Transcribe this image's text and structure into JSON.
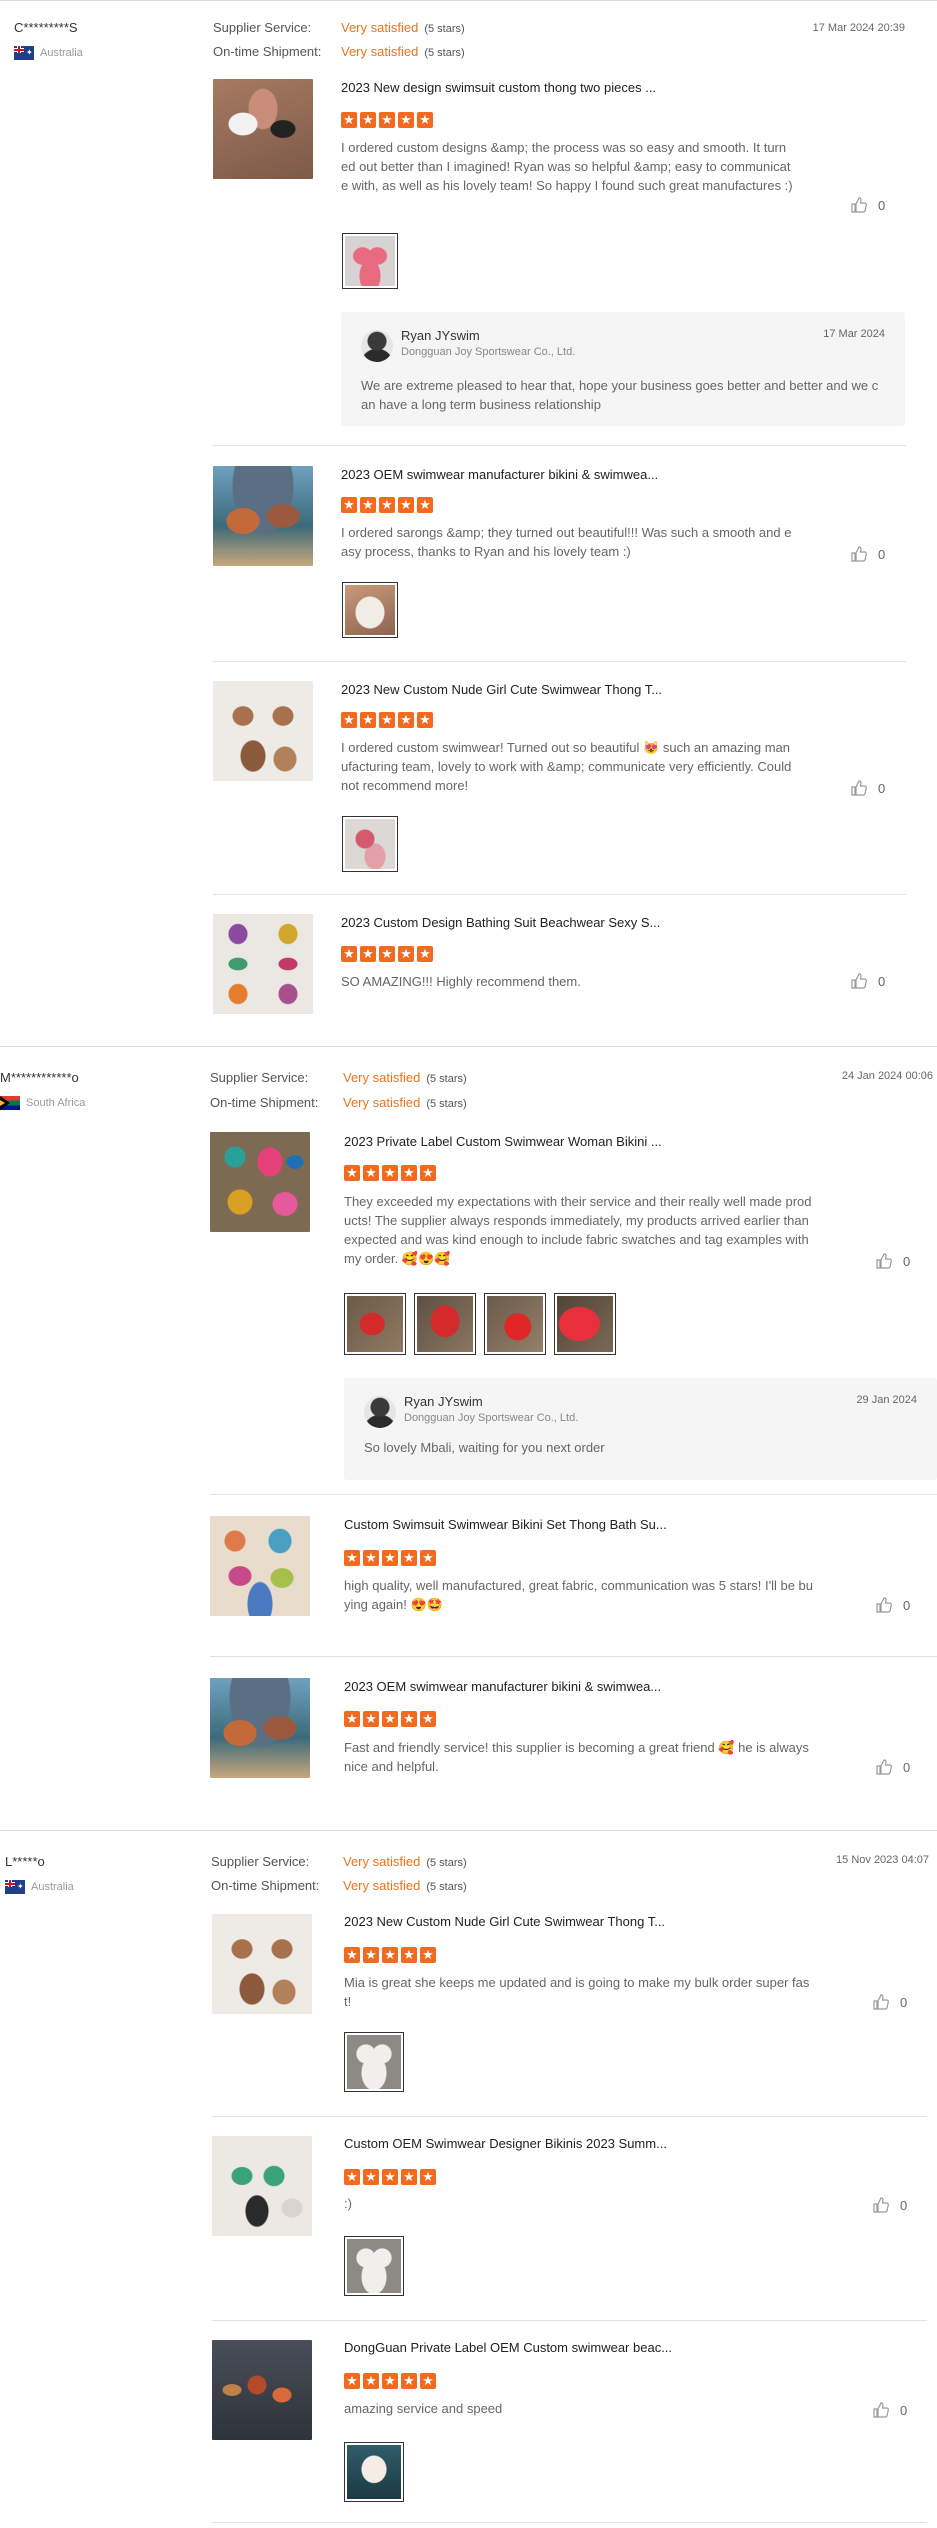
{
  "labels": {
    "supplier_service": "Supplier Service:",
    "ontime_shipment": "On-time Shipment:",
    "like_count": "0"
  },
  "reviews": [
    {
      "buyer": "C*********S",
      "country": "Australia",
      "flag_icon": "australia-flag-icon",
      "supplier_service": {
        "value": "Very satisfied",
        "stars": "(5 stars)"
      },
      "ontime_shipment": {
        "value": "Very satisfied",
        "stars": "(5 stars)"
      },
      "date": "17 Mar 2024 20:39",
      "items": [
        {
          "title": "2023 New design swimsuit custom thong two pieces ...",
          "rating": 5,
          "text": "I ordered custom designs &amp; the process was so easy and smooth. It turned out better than I imagined! Ryan was so helpful &amp; easy to communicate with, as well as his lovely team! So happy I found such great manufactures :)",
          "likes": "0",
          "photos": 1,
          "reply": {
            "name": "Ryan JYswim",
            "company": "Dongguan Joy Sportswear Co., Ltd.",
            "date": "17 Mar 2024",
            "text": "We are extreme pleased to hear that, hope your business goes better and better and we can have a long term business relationship"
          }
        },
        {
          "title": "2023 OEM swimwear manufacturer bikini & swimwea...",
          "rating": 5,
          "text": "I ordered sarongs &amp; they turned out beautiful!!! Was such a smooth and easy process, thanks to Ryan and his lovely team :)",
          "likes": "0",
          "photos": 1
        },
        {
          "title": "2023 New Custom Nude Girl Cute Swimwear Thong T...",
          "rating": 5,
          "text": "I ordered custom swimwear! Turned out so beautiful 😻 such an amazing manufacturing team, lovely to work with &amp; communicate very efficiently. Could not recommend more!",
          "likes": "0",
          "photos": 1
        },
        {
          "title": "2023 Custom Design Bathing Suit Beachwear Sexy S...",
          "rating": 5,
          "text": "SO AMAZING!!! Highly recommend them.",
          "likes": "0",
          "photos": 0
        }
      ]
    },
    {
      "buyer": "M************o",
      "country": "South Africa",
      "flag_icon": "south-africa-flag-icon",
      "supplier_service": {
        "value": "Very satisfied",
        "stars": "(5 stars)"
      },
      "ontime_shipment": {
        "value": "Very satisfied",
        "stars": "(5 stars)"
      },
      "date": "24 Jan 2024 00:06",
      "items": [
        {
          "title": "2023 Private Label Custom Swimwear Woman Bikini ...",
          "rating": 5,
          "text": "They exceeded my expectations with their service and their really well made products! The supplier always responds immediately, my products arrived earlier than expected and was kind enough to include fabric swatches and tag examples with my order. 🥰😍🥰",
          "likes": "0",
          "photos": 4,
          "reply": {
            "name": "Ryan JYswim",
            "company": "Dongguan Joy Sportswear Co., Ltd.",
            "date": "29 Jan 2024",
            "text": "So lovely Mbali, waiting for you next order"
          }
        },
        {
          "title": "Custom Swimsuit Swimwear Bikini Set Thong Bath Su...",
          "rating": 5,
          "text": "high quality, well manufactured, great fabric, communication was 5 stars! I'll be buying again! 😍🤩",
          "likes": "0",
          "photos": 0
        },
        {
          "title": "2023 OEM swimwear manufacturer bikini & swimwea...",
          "rating": 5,
          "text": "Fast and friendly service! this supplier is becoming a great friend 🥰 he is always nice and helpful.",
          "likes": "0",
          "photos": 0
        }
      ]
    },
    {
      "buyer": "L*****o",
      "country": "Australia",
      "flag_icon": "australia-flag-icon",
      "supplier_service": {
        "value": "Very satisfied",
        "stars": "(5 stars)"
      },
      "ontime_shipment": {
        "value": "Very satisfied",
        "stars": "(5 stars)"
      },
      "date": "15 Nov 2023 04:07",
      "items": [
        {
          "title": "2023 New Custom Nude Girl Cute Swimwear Thong T...",
          "rating": 5,
          "text": "Mia is great she keeps me updated and is going to make my bulk order super fast!",
          "likes": "0",
          "photos": 1
        },
        {
          "title": "Custom OEM Swimwear Designer Bikinis 2023 Summ...",
          "rating": 5,
          "text": ":)",
          "likes": "0",
          "photos": 1
        },
        {
          "title": "DongGuan Private Label OEM Custom swimwear beac...",
          "rating": 5,
          "text": "amazing service and speed",
          "likes": "0",
          "photos": 1
        }
      ]
    }
  ],
  "colors": {
    "accent": "#e8731a",
    "star": "#f26a20",
    "text": "#333333",
    "muted": "#666666",
    "reply_bg": "#f5f5f5"
  }
}
